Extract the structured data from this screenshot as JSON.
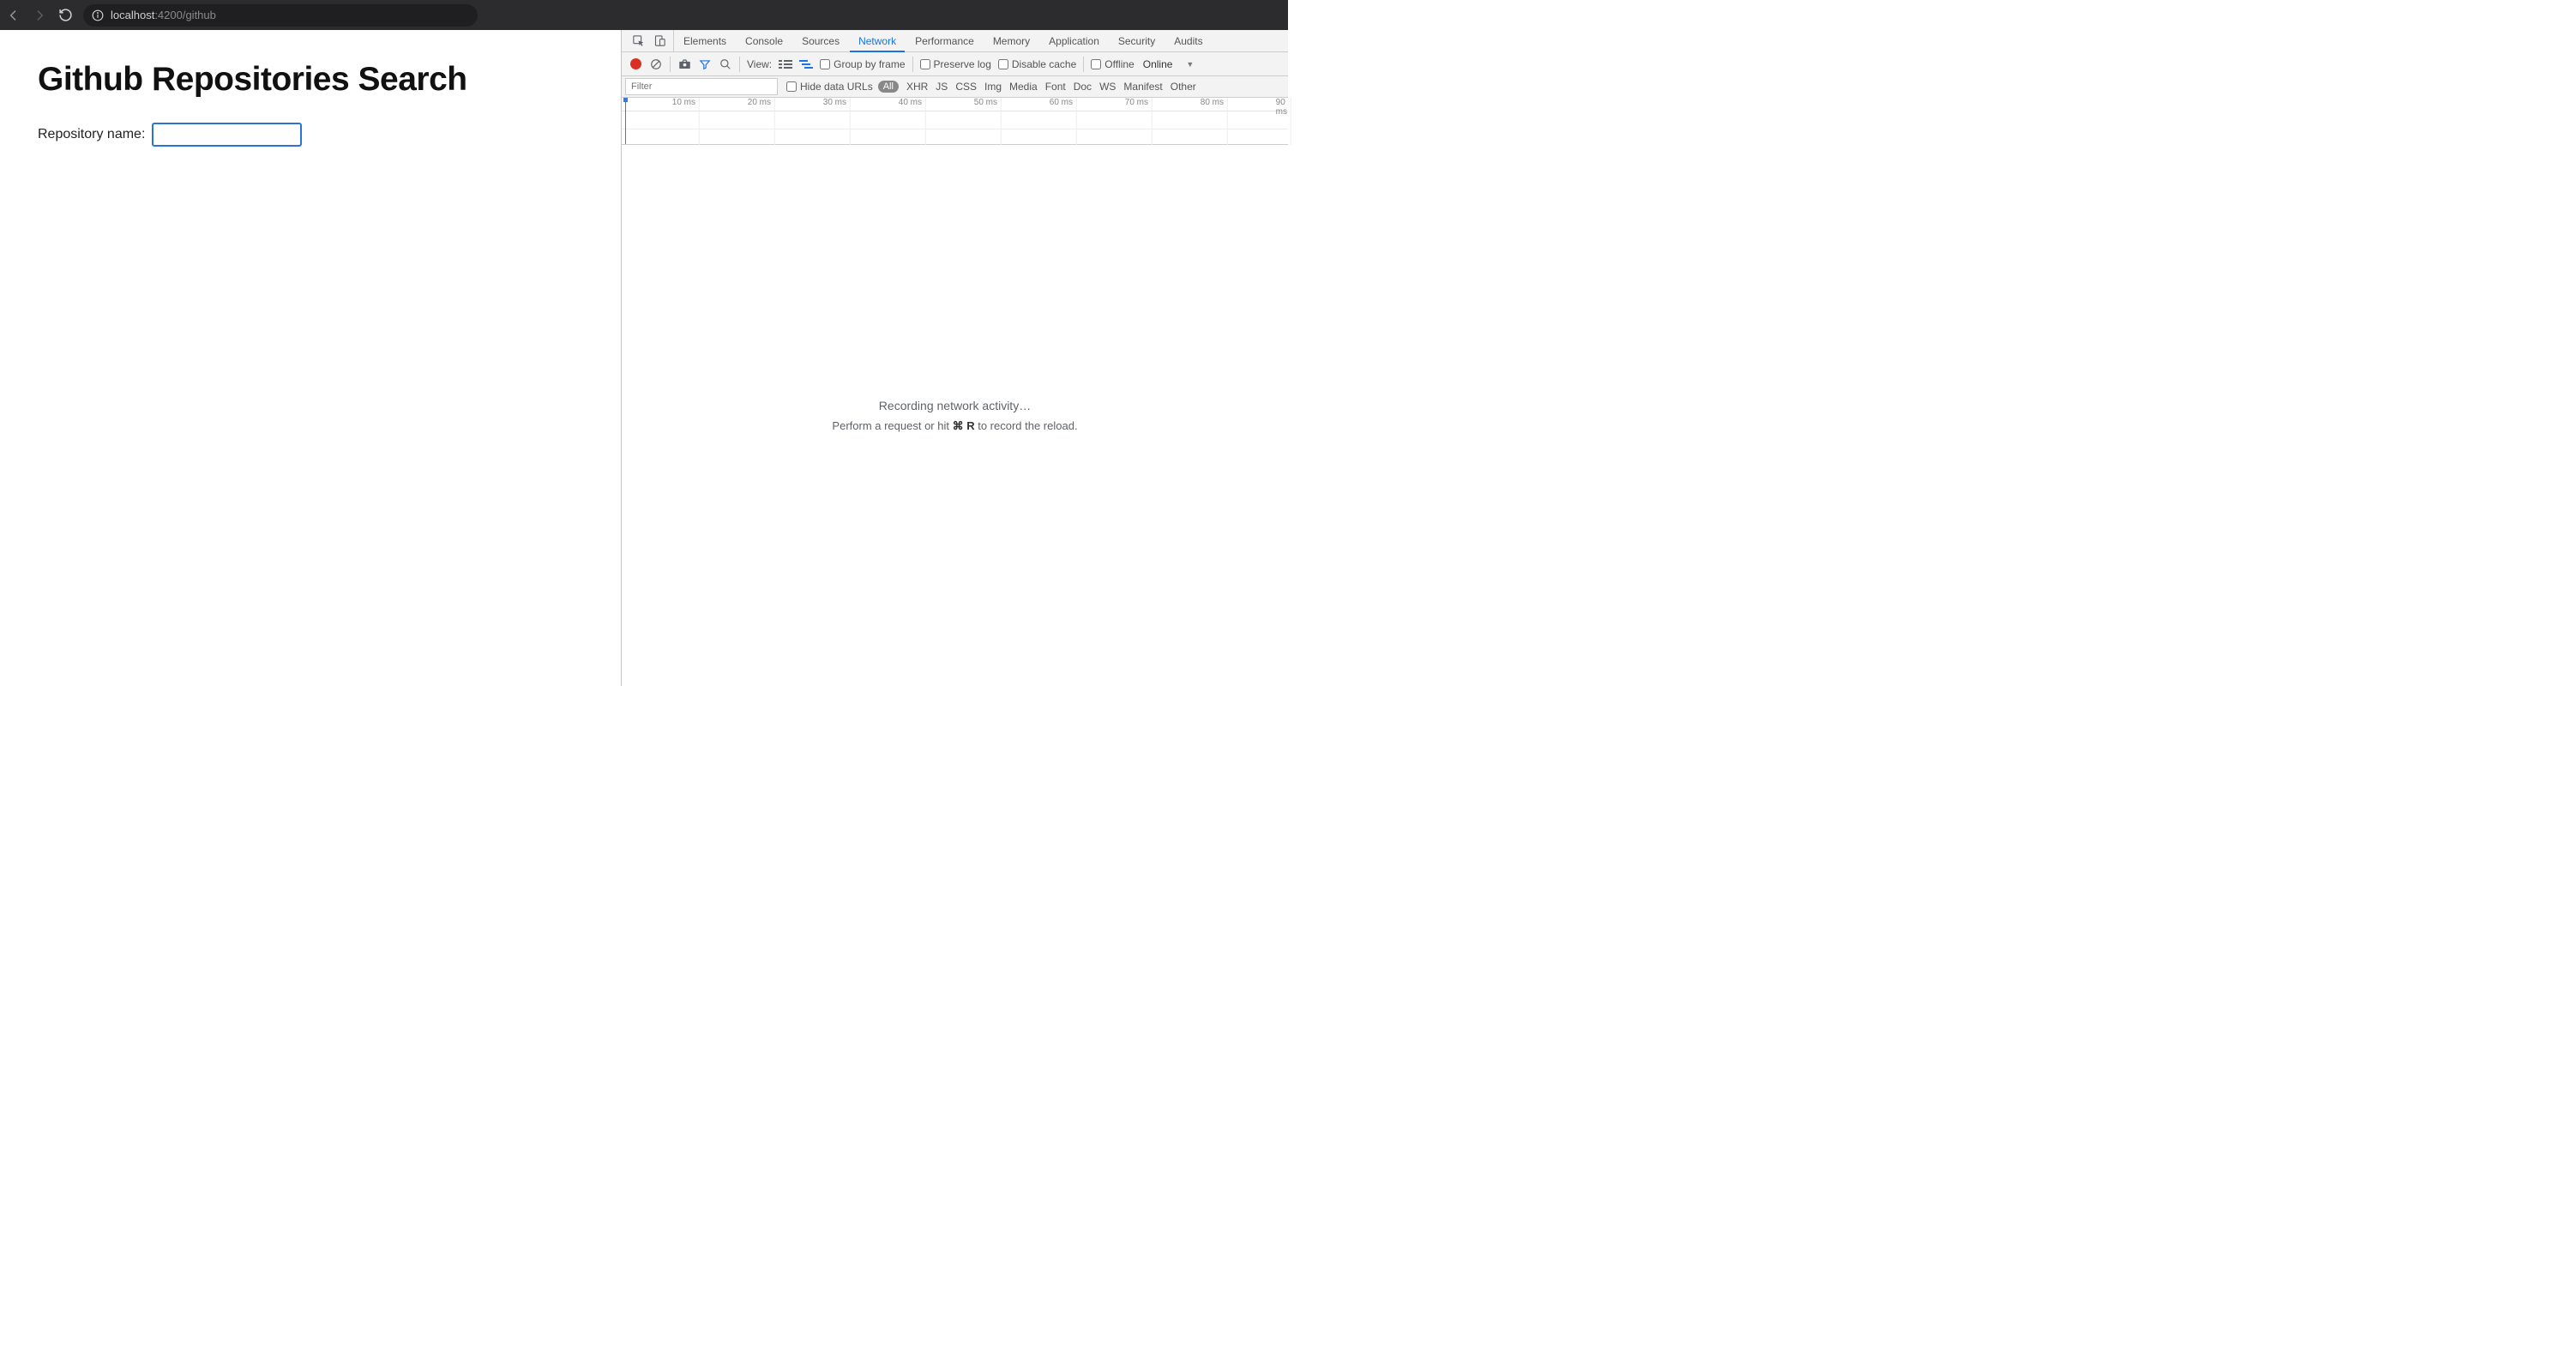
{
  "browser": {
    "url_host": "localhost",
    "url_port_path": ":4200/github"
  },
  "page": {
    "title": "Github Repositories Search",
    "label": "Repository name:",
    "input_value": ""
  },
  "devtools": {
    "tabs": [
      "Elements",
      "Console",
      "Sources",
      "Network",
      "Performance",
      "Memory",
      "Application",
      "Security",
      "Audits"
    ],
    "active_tab": "Network",
    "toolbar": {
      "view_label": "View:",
      "group_by_frame": "Group by frame",
      "preserve_log": "Preserve log",
      "disable_cache": "Disable cache",
      "offline": "Offline",
      "online": "Online"
    },
    "filter": {
      "placeholder": "Filter",
      "hide_data_urls": "Hide data URLs",
      "types": [
        "All",
        "XHR",
        "JS",
        "CSS",
        "Img",
        "Media",
        "Font",
        "Doc",
        "WS",
        "Manifest",
        "Other"
      ]
    },
    "timeline_ticks": [
      "10 ms",
      "20 ms",
      "30 ms",
      "40 ms",
      "50 ms",
      "60 ms",
      "70 ms",
      "80 ms",
      "90 ms"
    ],
    "empty": {
      "line1": "Recording network activity…",
      "line2_a": "Perform a request or hit ",
      "line2_key": "⌘ R",
      "line2_b": " to record the reload."
    }
  }
}
